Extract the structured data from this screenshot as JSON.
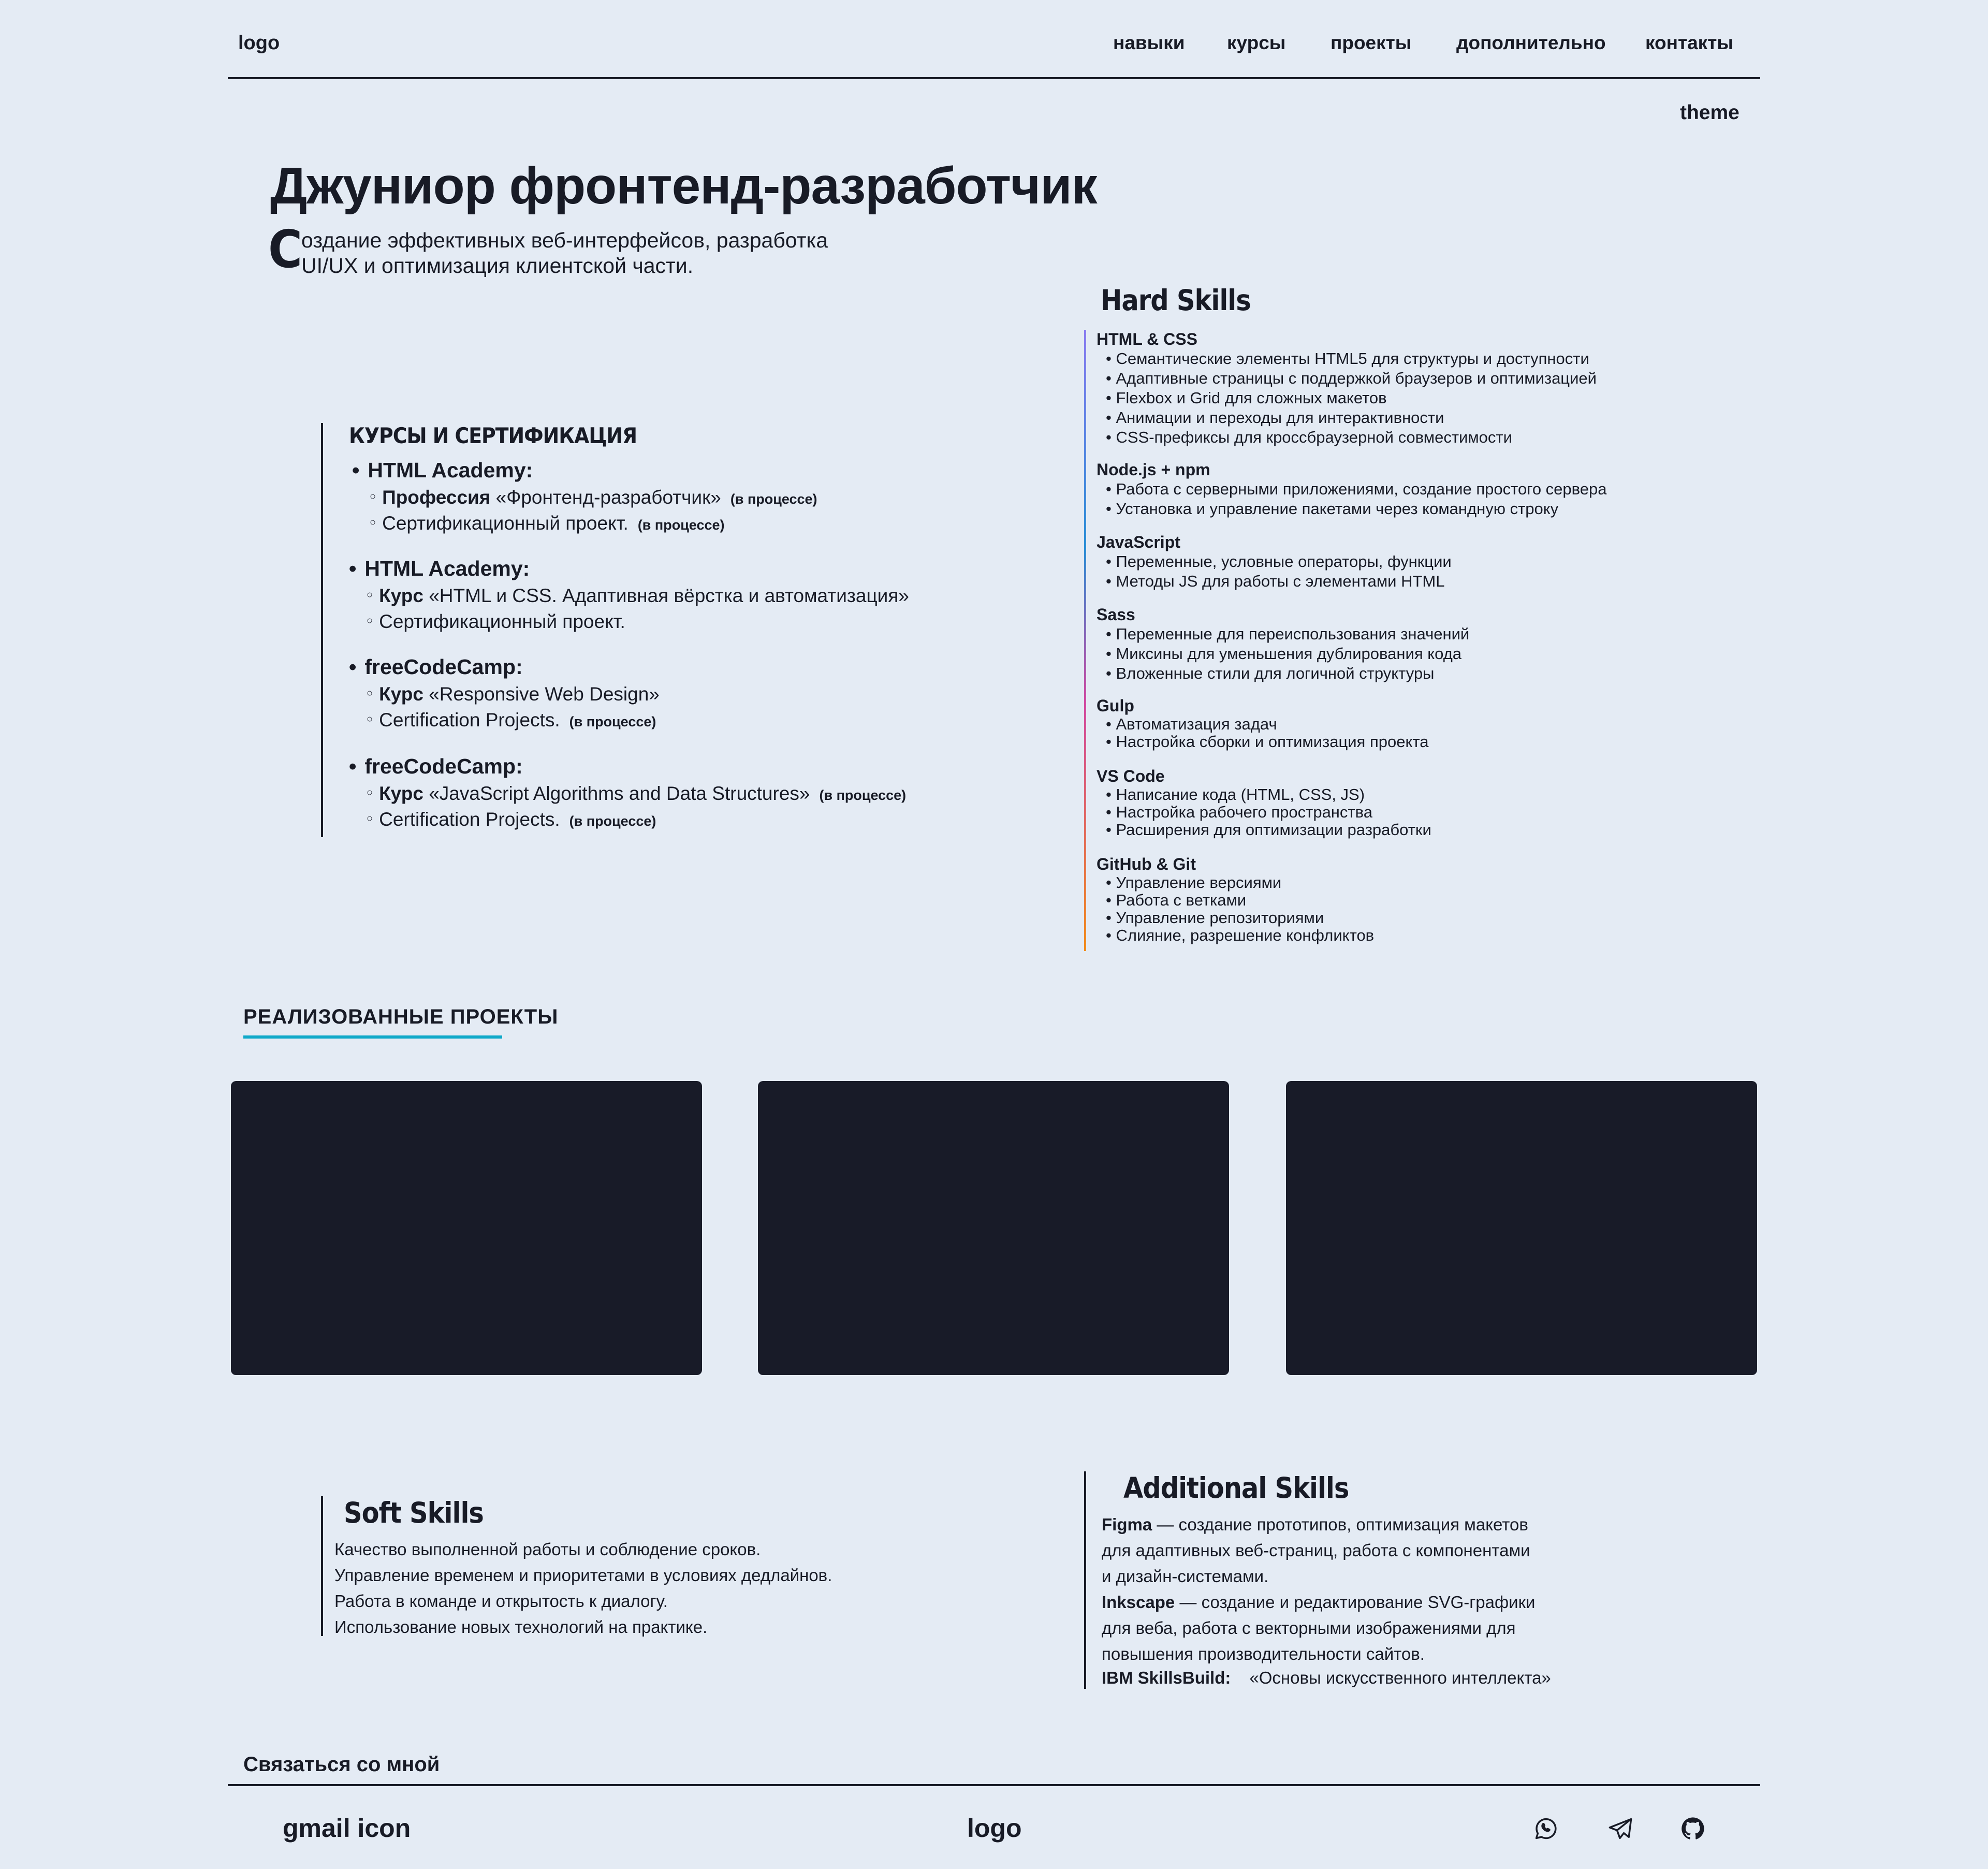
{
  "header": {
    "logo": "logo",
    "nav": [
      "навыки",
      "курсы",
      "проекты",
      "дополнительно",
      "контакты"
    ],
    "theme": "theme"
  },
  "hero": {
    "title": "Джуниор фронтенд-разработчик",
    "dropcap": "С",
    "line1": "оздание эффективных веб-интерфейсов, разработка",
    "line2": "UI/UX и оптимизация клиентской части."
  },
  "courses": {
    "title": "КУРСЫ И СЕРТИФИКАЦИЯ",
    "items": [
      {
        "name": "HTML  Academy:",
        "lines": [
          {
            "bold": "Профессия",
            "text": " «Фронтенд-разработчик»",
            "status": "(в процессе)"
          },
          {
            "bold": "",
            "text": "Сертификационный проект.",
            "status": "(в процессе)"
          }
        ]
      },
      {
        "name": "HTML  Academy:",
        "lines": [
          {
            "bold": "Курс",
            "text": "  «HTML и CSS. Адаптивная вёрстка и автоматизация»",
            "status": ""
          },
          {
            "bold": "",
            "text": "Сертификационный проект.",
            "status": ""
          }
        ]
      },
      {
        "name": "freeCodeCamp:",
        "lines": [
          {
            "bold": "Курс",
            "text": "  «Responsive Web Design»",
            "status": ""
          },
          {
            "bold": "",
            "text": "Certification Projects.",
            "status": "(в процессе)"
          }
        ]
      },
      {
        "name": "freeCodeCamp:",
        "lines": [
          {
            "bold": "Курс",
            "text": "  «JavaScript Algorithms and Data Structures»",
            "status": "(в процессе)"
          },
          {
            "bold": "",
            "text": "Certification Projects.",
            "status": "(в процессе)"
          }
        ]
      }
    ]
  },
  "hard_skills": {
    "title": "Hard Skills",
    "groups": [
      {
        "name": "HTML & CSS",
        "items": [
          "Семантические элементы HTML5 для структуры и доступности",
          "Адаптивные страницы с поддержкой браузеров и оптимизацией",
          "Flexbox и Grid для сложных макетов",
          "Анимации и переходы для интерактивности",
          "CSS-префиксы для кроссбраузерной совместимости"
        ]
      },
      {
        "name": "Node.js + npm",
        "items": [
          "Работа с серверными приложениями, создание  простого сервера",
          "Установка и управление пакетами через командную строку"
        ]
      },
      {
        "name": "JavaScript",
        "items": [
          "Переменные, условные операторы, функции",
          "Методы JS для работы с элементами HTML"
        ]
      },
      {
        "name": "Sass",
        "items": [
          "Переменные для переиспользования значений",
          "Миксины для уменьшения дублирования кода",
          "Вложенные стили для логичной структуры"
        ]
      },
      {
        "name": "Gulp",
        "items": [
          "Автоматизация задач",
          "Настройка сборки и оптимизация проекта"
        ]
      },
      {
        "name": "VS Code",
        "items": [
          "Написание кода (HTML, CSS, JS)",
          "Настройка рабочего пространства",
          "Расширения для оптимизации разработки"
        ]
      },
      {
        "name": "GitHub & Git",
        "items": [
          "Управление версиями",
          "Работа с ветками",
          "Управление репозиториями",
          "Слияние, разрешение конфликтов"
        ]
      }
    ]
  },
  "projects": {
    "title": "РЕАЛИЗОВАННЫЕ ПРОЕКТЫ",
    "accent": "#0fa9c9",
    "card_color": "#181b28"
  },
  "soft_skills": {
    "title": "Soft Skills",
    "lines": [
      "Качество выполненной работы и соблюдение сроков.",
      "Управление временем и приоритетами в условиях дедлайнов.",
      "Работа в команде и открытость к диалогу.",
      "Использование новых технологий  на практике."
    ]
  },
  "additional_skills": {
    "title": "Additional Skills",
    "figma_label": "Figma",
    "figma_line1": " — создание прототипов, оптимизация макетов",
    "figma_line2": "для адаптивных веб-страниц, работа с компонентами",
    "figma_line3": "и дизайн-системами.",
    "inkscape_label": "Inkscape",
    "inkscape_line1": " — создание и редактирование SVG-графики",
    "inkscape_line2": "для веба, работа с векторными изображениями для",
    "inkscape_line3": "повышения производительности сайтов.",
    "ibm_label": "IBM SkillsBuild:",
    "ibm_text": "«Основы искусственного интеллекта»"
  },
  "footer": {
    "contact_title": "Связаться со мной",
    "gmail": "gmail icon",
    "logo": "logo",
    "icons": [
      "whatsapp-icon",
      "telegram-icon",
      "github-icon"
    ]
  }
}
